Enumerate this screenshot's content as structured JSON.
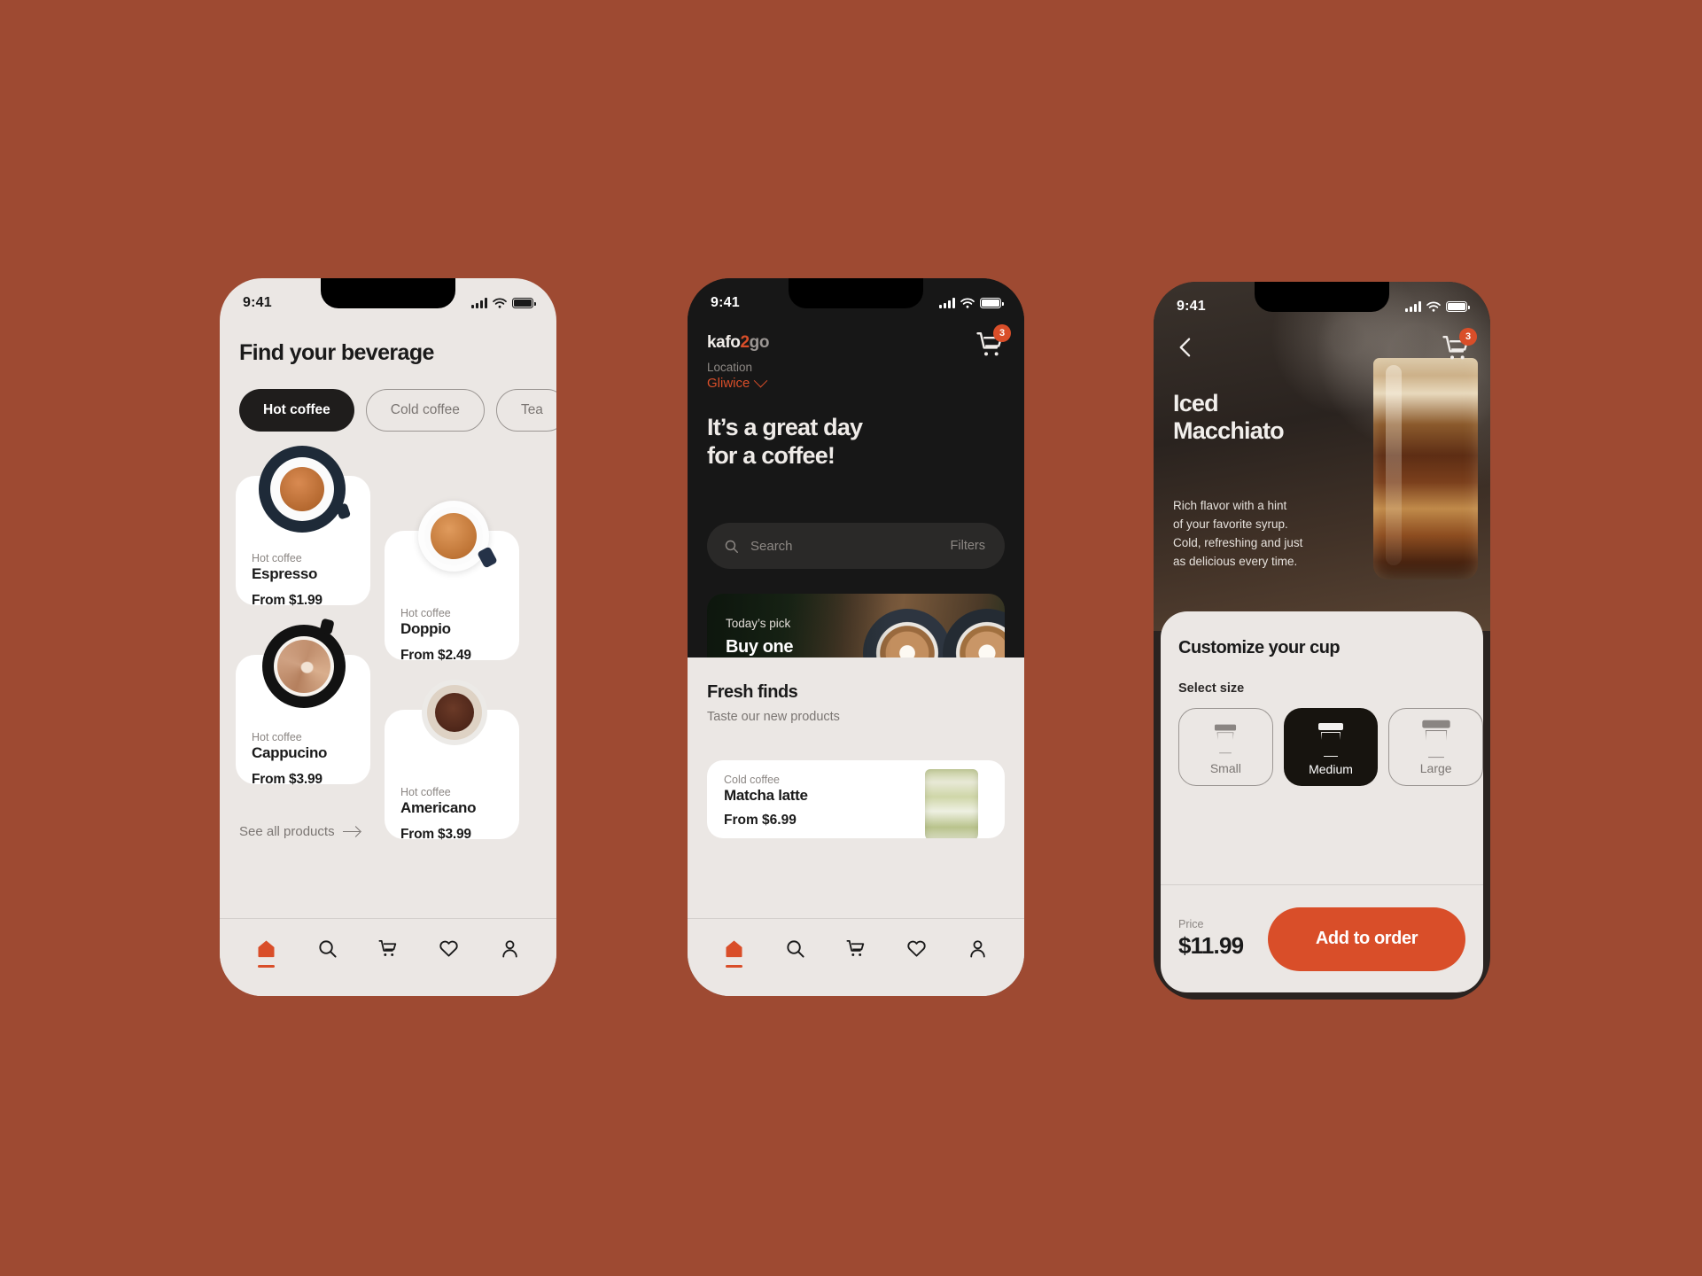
{
  "colors": {
    "background": "#9e4a32",
    "accent": "#d94e29",
    "dark": "#171717",
    "surface": "#ebe7e4",
    "card": "#ffffff",
    "muted": "#7b7673"
  },
  "status_bar": {
    "time": "9:41",
    "signal_icon": "cellular-bars-icon",
    "wifi_icon": "wifi-icon",
    "battery_icon": "battery-icon"
  },
  "nav": {
    "items": [
      {
        "name": "home",
        "icon": "home-icon",
        "active": true
      },
      {
        "name": "search",
        "icon": "search-icon",
        "active": false
      },
      {
        "name": "cart",
        "icon": "cart-icon",
        "active": false
      },
      {
        "name": "favorites",
        "icon": "heart-icon",
        "active": false
      },
      {
        "name": "profile",
        "icon": "person-icon",
        "active": false
      }
    ]
  },
  "phone1": {
    "title": "Find your beverage",
    "chips": [
      {
        "label": "Hot coffee",
        "active": true
      },
      {
        "label": "Cold coffee",
        "active": false
      },
      {
        "label": "Tea",
        "active": false
      }
    ],
    "products": [
      {
        "category": "Hot coffee",
        "name": "Espresso",
        "price": "From $1.99"
      },
      {
        "category": "Hot coffee",
        "name": "Doppio",
        "price": "From $2.49"
      },
      {
        "category": "Hot coffee",
        "name": "Cappucino",
        "price": "From $3.99"
      },
      {
        "category": "Hot coffee",
        "name": "Americano",
        "price": "From $3.99"
      }
    ],
    "see_all": "See all products"
  },
  "phone2": {
    "brand": {
      "part1": "kafo",
      "part2": "2",
      "part3": "go"
    },
    "location_label": "Location",
    "location_value": "Gliwice",
    "cart_badge": "3",
    "headline": "It’s a great day\nfor a coffee!",
    "search": {
      "placeholder": "Search",
      "filters_label": "Filters",
      "icon": "search-icon"
    },
    "promo": {
      "kicker": "Today’s pick",
      "headline": "Buy one\nget one free"
    },
    "fresh": {
      "title": "Fresh finds",
      "subtitle": "Taste our new products"
    },
    "fresh_product": {
      "category": "Cold coffee",
      "name": "Matcha latte",
      "price": "From $6.99"
    }
  },
  "phone3": {
    "back_icon": "chevron-left-icon",
    "cart_badge": "3",
    "title": "Iced\nMacchiato",
    "description": "Rich flavor with a hint\nof your favorite syrup.\nCold, refreshing and just\nas delicious every time.",
    "customize_title": "Customize your cup",
    "select_size_label": "Select size",
    "sizes": [
      {
        "label": "Small",
        "selected": false
      },
      {
        "label": "Medium",
        "selected": true
      },
      {
        "label": "Large",
        "selected": false
      }
    ],
    "price_label": "Price",
    "price_value": "$11.99",
    "add_button": "Add to order"
  }
}
